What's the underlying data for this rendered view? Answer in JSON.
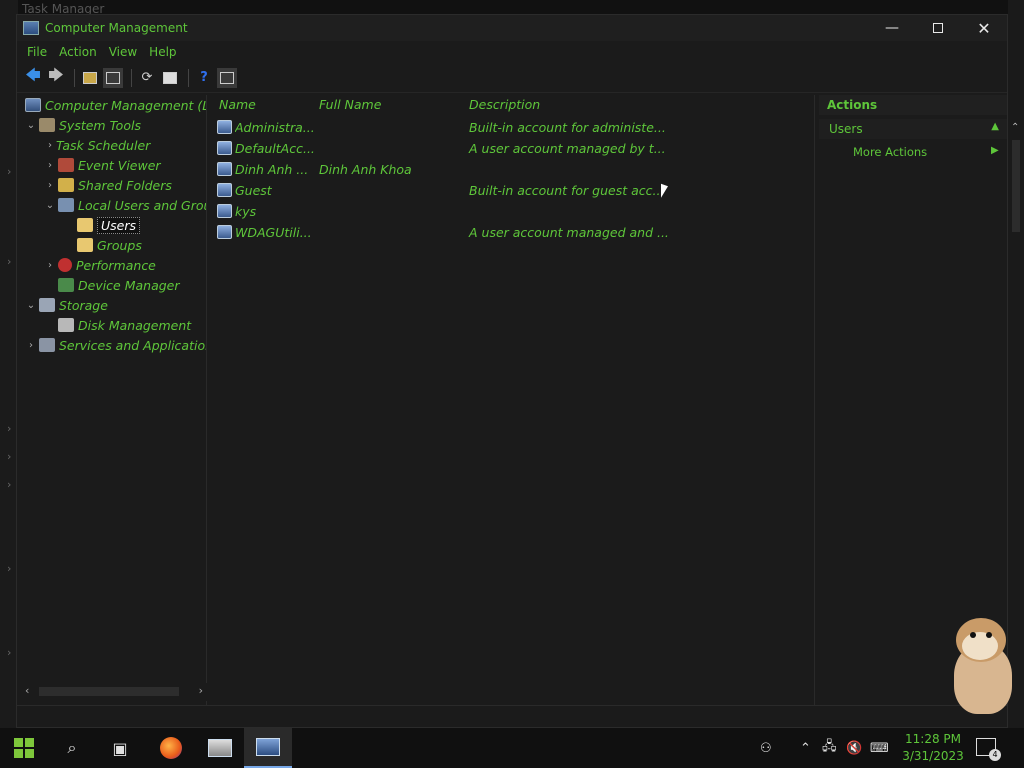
{
  "background_window": {
    "title": "Task Manager"
  },
  "window": {
    "title": "Computer Management",
    "controls": {
      "minimize": "—",
      "close": "✕"
    }
  },
  "menu": [
    "File",
    "Action",
    "View",
    "Help"
  ],
  "tree": {
    "items": [
      {
        "label": "Computer Management (Lo",
        "expander": "",
        "icon": "computer-management-icon"
      },
      {
        "label": "System Tools",
        "expander": "⌄",
        "icon": "system-tools-icon"
      },
      {
        "label": "Task Scheduler",
        "expander": "›",
        "icon": "task-scheduler-icon"
      },
      {
        "label": "Event Viewer",
        "expander": "›",
        "icon": "event-viewer-icon"
      },
      {
        "label": "Shared Folders",
        "expander": "›",
        "icon": "shared-folders-icon"
      },
      {
        "label": "Local Users and Grou",
        "expander": "⌄",
        "icon": "local-users-icon"
      },
      {
        "label": "Users",
        "expander": "",
        "icon": "folder-icon",
        "selected": true
      },
      {
        "label": "Groups",
        "expander": "",
        "icon": "folder-icon"
      },
      {
        "label": "Performance",
        "expander": "›",
        "icon": "performance-icon"
      },
      {
        "label": "Device Manager",
        "expander": "",
        "icon": "device-manager-icon"
      },
      {
        "label": "Storage",
        "expander": "⌄",
        "icon": "storage-icon"
      },
      {
        "label": "Disk Management",
        "expander": "",
        "icon": "disk-management-icon"
      },
      {
        "label": "Services and Applicatior",
        "expander": "›",
        "icon": "services-icon"
      }
    ]
  },
  "list": {
    "columns": [
      "Name",
      "Full Name",
      "Description"
    ],
    "rows": [
      {
        "name": "Administra...",
        "full_name": "",
        "description": "Built-in account for administe..."
      },
      {
        "name": "DefaultAcc...",
        "full_name": "",
        "description": "A user account managed by t..."
      },
      {
        "name": "Dinh Anh ...",
        "full_name": "Dinh Anh Khoa",
        "description": ""
      },
      {
        "name": "Guest",
        "full_name": "",
        "description": "Built-in account for guest acc..."
      },
      {
        "name": "kys",
        "full_name": "",
        "description": ""
      },
      {
        "name": "WDAGUtili...",
        "full_name": "",
        "description": "A user account managed and ..."
      }
    ]
  },
  "actions": {
    "header": "Actions",
    "section": "Users",
    "items": [
      "More Actions"
    ]
  },
  "taskbar": {
    "clock_time": "11:28 PM",
    "clock_date": "3/31/2023",
    "notification_count": "4"
  },
  "colors": {
    "accent_text": "#5ec63a",
    "window_bg": "#1b1b1b",
    "taskbar_bg": "#101010"
  }
}
